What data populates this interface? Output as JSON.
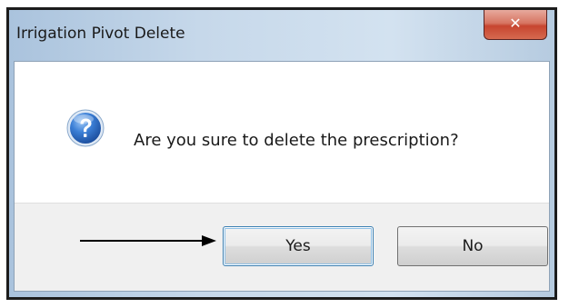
{
  "window": {
    "title": "Irrigation Pivot Delete",
    "close_symbol": "✕"
  },
  "message": {
    "icon": "question-icon",
    "text": "Are you sure to delete the prescription?"
  },
  "buttons": {
    "yes_label": "Yes",
    "no_label": "No"
  },
  "colors": {
    "close_button": "#c74530",
    "question_icon": "#1f5fb8",
    "default_button_border": "#3c7fb1"
  }
}
